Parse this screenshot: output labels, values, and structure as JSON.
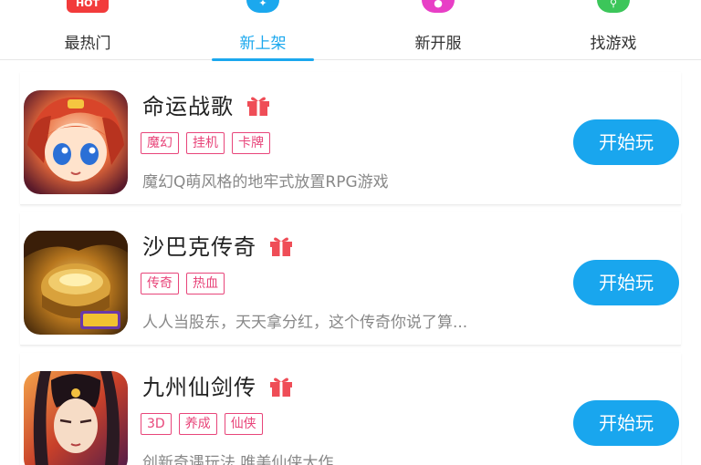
{
  "tabs": [
    {
      "label": "最热门",
      "icon": "hot-icon",
      "icon_text": "HOT",
      "color": "#f23b3b",
      "active": false
    },
    {
      "label": "新上架",
      "icon": "new-icon",
      "icon_text": "",
      "color": "#1ba8ee",
      "active": true
    },
    {
      "label": "新开服",
      "icon": "new-server-icon",
      "icon_text": "",
      "color": "#e83fc6",
      "active": false
    },
    {
      "label": "找游戏",
      "icon": "search-icon",
      "icon_text": "",
      "color": "#3cc65a",
      "active": false
    }
  ],
  "colors": {
    "accent": "#1ba8ee",
    "tag": "#e8457a",
    "gift": "#ef4d57"
  },
  "games": [
    {
      "name": "命运战歌",
      "tags": [
        "魔幻",
        "挂机",
        "卡牌"
      ],
      "desc": "魔幻Q萌风格的地牢式放置RPG游戏",
      "button": "开始玩"
    },
    {
      "name": "沙巴克传奇",
      "tags": [
        "传奇",
        "热血"
      ],
      "desc": "人人当股东，天天拿分红，这个传奇你说了算...",
      "button": "开始玩"
    },
    {
      "name": "九州仙剑传",
      "tags": [
        "3D",
        "养成",
        "仙侠"
      ],
      "desc": "创新奇遇玩法 唯美仙侠大作",
      "button": "开始玩"
    }
  ]
}
